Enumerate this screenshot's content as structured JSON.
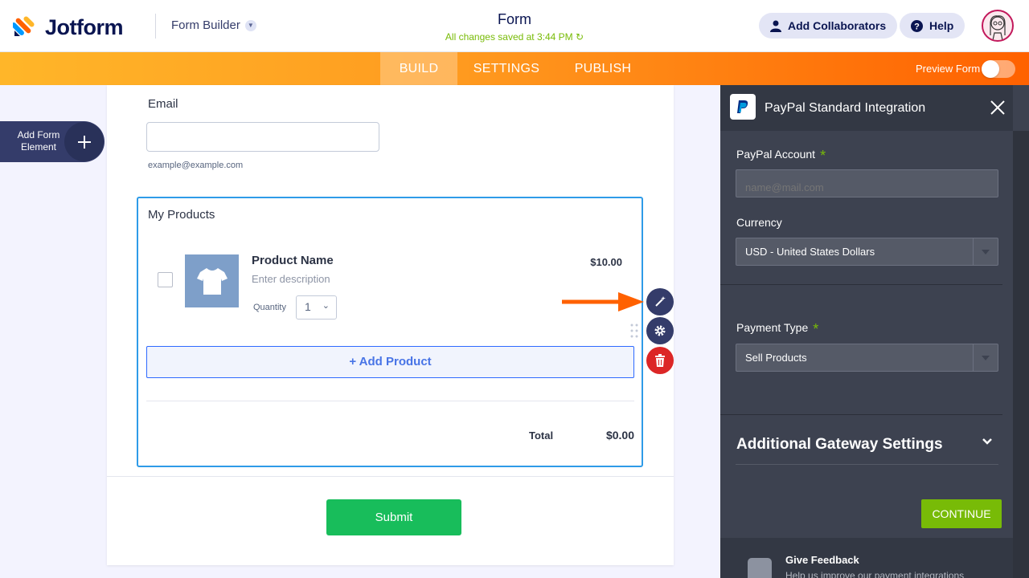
{
  "header": {
    "logo_text": "Jotform",
    "builder_label": "Form Builder",
    "form_title": "Form",
    "save_status": "All changes saved at 3:44 PM",
    "collaborators_label": "Add Collaborators",
    "help_label": "Help"
  },
  "nav": {
    "tabs": [
      "BUILD",
      "SETTINGS",
      "PUBLISH"
    ],
    "active_tab": "BUILD",
    "preview_label": "Preview Form",
    "preview_enabled": false
  },
  "left": {
    "add_element_label": "Add Form Element"
  },
  "form": {
    "email": {
      "label": "Email",
      "value": "",
      "sublabel": "example@example.com"
    },
    "products": {
      "title": "My Products",
      "item": {
        "name": "Product Name",
        "description_placeholder": "Enter description",
        "price": "$10.00",
        "quantity_label": "Quantity",
        "quantity_value": "1"
      },
      "add_product_label": "+ Add Product",
      "total_label": "Total",
      "total_value": "$0.00"
    },
    "submit_label": "Submit"
  },
  "panel": {
    "title": "PayPal Standard Integration",
    "account": {
      "label": "PayPal Account",
      "placeholder": "name@mail.com",
      "value": ""
    },
    "currency": {
      "label": "Currency",
      "value": "USD - United States Dollars"
    },
    "payment_type": {
      "label": "Payment Type",
      "value": "Sell Products"
    },
    "required_mark": "*",
    "additional_settings_label": "Additional Gateway Settings",
    "continue_label": "CONTINUE",
    "feedback": {
      "title": "Give Feedback",
      "subtitle": "Help us improve our payment integrations"
    }
  },
  "colors": {
    "brand_orange": "#ff6100",
    "accent_blue": "#2e9be8",
    "submit_green": "#18bd5b",
    "continue_green": "#78bb07",
    "delete_red": "#dc2626",
    "panel_bg": "#3d4250"
  },
  "icons": {
    "logo": "jotform-logo-icon",
    "collaborators": "user-icon",
    "help": "question-icon",
    "refresh": "refresh-icon",
    "add": "plus-icon",
    "wand": "magic-wand-icon",
    "settings": "gear-icon",
    "delete": "trash-icon",
    "close": "close-icon",
    "paypal": "paypal-icon",
    "chevron": "chevron-down-icon"
  }
}
